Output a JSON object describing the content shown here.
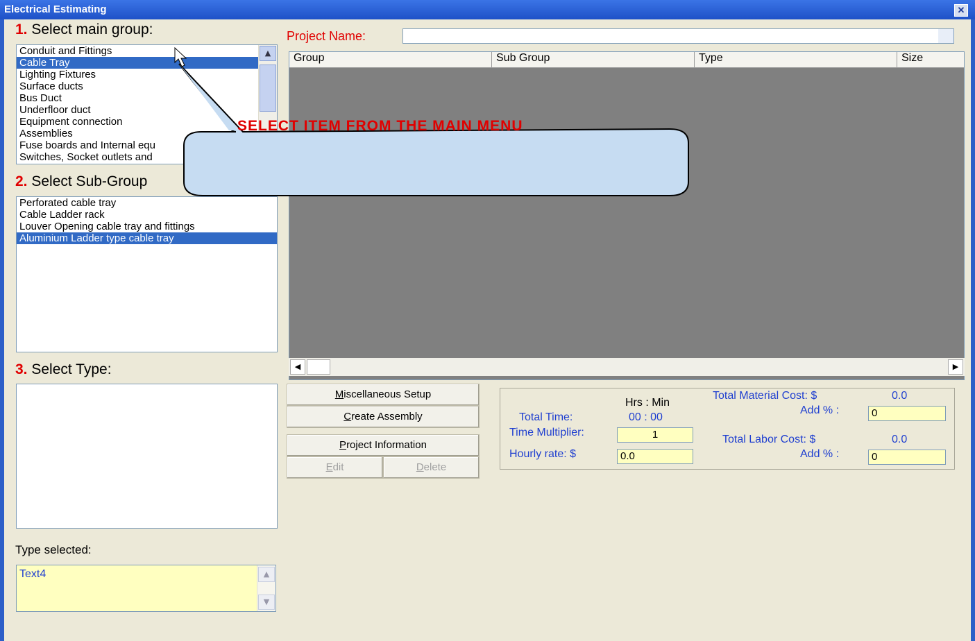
{
  "window": {
    "title": "Electrical Estimating",
    "close_glyph": "✕"
  },
  "step1": {
    "num": "1.",
    "label": "Select main group:",
    "items": [
      "Conduit and Fittings",
      "Cable Tray",
      "Lighting Fixtures",
      "Surface ducts",
      "Bus Duct",
      "Underfloor duct",
      "Equipment connection",
      "Assemblies",
      "Fuse boards and Internal equ",
      "Switches, Socket outlets and"
    ],
    "selected_index": 1
  },
  "step2": {
    "num": "2.",
    "label": "Select Sub-Group",
    "items": [
      "Perforated cable tray",
      "Cable Ladder rack",
      "Louver Opening cable tray and fittings",
      "Aluminium Ladder type cable tray"
    ],
    "selected_index": 3
  },
  "step3": {
    "num": "3.",
    "label": "Select Type:"
  },
  "type_selected": {
    "label": "Type selected:",
    "value": "Text4"
  },
  "project": {
    "label": "Project Name:",
    "value": ""
  },
  "grid": {
    "columns": [
      "Group",
      "Sub Group",
      "Type",
      "Size"
    ]
  },
  "buttons": {
    "misc_pre": "M",
    "misc_post": "iscellaneous Setup",
    "assembly_pre": "C",
    "assembly_post": "reate Assembly",
    "projinfo_pre": "P",
    "projinfo_post": "roject Information",
    "edit_pre": "E",
    "edit_post": "dit",
    "delete_pre": "D",
    "delete_post": "elete"
  },
  "totals": {
    "hrs_min_label": "Hrs : Min",
    "total_time_label": "Total Time:",
    "total_time_value": "00 : 00",
    "time_multiplier_label": "Time Multiplier:",
    "time_multiplier_value": "1",
    "hourly_rate_label": "Hourly rate: $",
    "hourly_rate_value": "0.0",
    "material_cost_label": "Total Material Cost: $",
    "material_cost_value": "0.0",
    "material_add_label": "Add % :",
    "material_add_value": "0",
    "labor_cost_label": "Total Labor Cost: $",
    "labor_cost_value": "0.0",
    "labor_add_label": "Add % :",
    "labor_add_value": "0"
  },
  "callout": {
    "text": "SELECT ITEM FROM THE MAIN MENU"
  },
  "icons": {
    "scroll_up": "▲",
    "scroll_down": "▼",
    "scroll_left": "◀",
    "scroll_right": "▶"
  },
  "colors": {
    "accent_red": "#e00000",
    "label_blue": "#1f3fd0",
    "selection": "#316ac5",
    "yellow_field": "#ffffc0"
  }
}
